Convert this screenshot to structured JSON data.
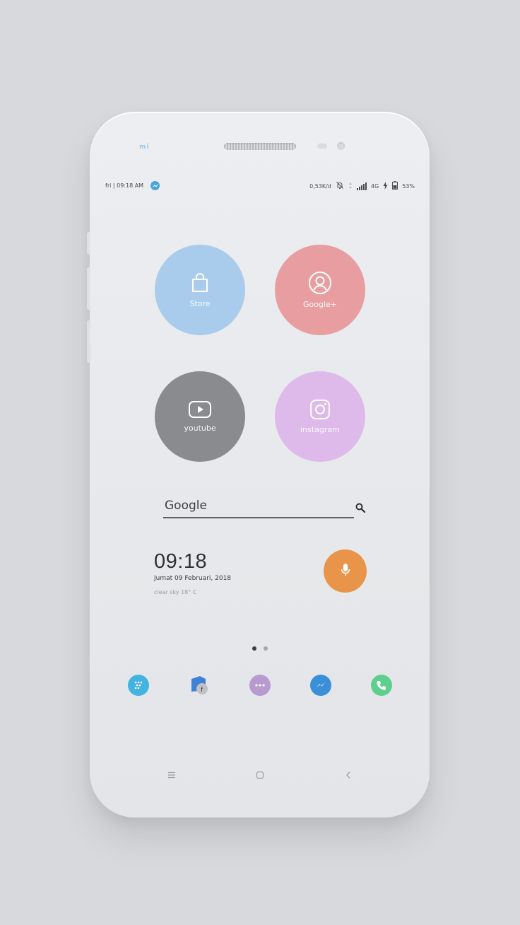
{
  "device": {
    "brand": "mi"
  },
  "status_bar": {
    "left_text": "fri | 09:18 AM",
    "notification_icon": "signal-app-icon",
    "speed": "0,53K/d",
    "network": "4G",
    "battery": "53%"
  },
  "apps": [
    {
      "label": "Store",
      "icon": "shopping-bag-icon",
      "color": "#a9ccec"
    },
    {
      "label": "Google+",
      "icon": "profile-icon",
      "color": "#e89ea0"
    },
    {
      "label": "youtube",
      "icon": "play-icon",
      "color": "#8a8b8e"
    },
    {
      "label": "instagram",
      "icon": "instagram-icon",
      "color": "#ddbaea"
    }
  ],
  "search": {
    "label": "Google",
    "icon": "search-icon"
  },
  "clock": {
    "time": "09:18",
    "date": "Jumat 09 Februari, 2018",
    "weather": "clear sky 18°   C"
  },
  "mic": {
    "icon": "microphone-icon",
    "color": "#e8954a"
  },
  "pager": {
    "pages": 2,
    "current": 1
  },
  "dock": [
    {
      "icon": "blackberry-messenger-icon",
      "color": "#43b3e0"
    },
    {
      "icon": "facebook-icon",
      "color": "#3f82d4"
    },
    {
      "icon": "messaging-icon",
      "color": "#b79bd0"
    },
    {
      "icon": "messenger-icon",
      "color": "#3b8ed8"
    },
    {
      "icon": "phone-icon",
      "color": "#5fcf8e"
    }
  ],
  "nav": [
    {
      "icon": "menu-icon"
    },
    {
      "icon": "home-icon"
    },
    {
      "icon": "back-icon"
    }
  ]
}
